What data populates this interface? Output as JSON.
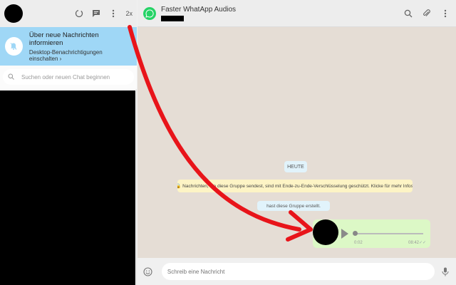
{
  "sidebar": {
    "speed_label": "2x",
    "notification": {
      "title": "Über neue Nachrichten informieren",
      "subtitle": "Desktop-Benachrichtigungen einschalten ›"
    },
    "search": {
      "placeholder": "Suchen oder neuen Chat beginnen"
    }
  },
  "chat": {
    "title": "Faster WhatApp Audios",
    "logo_text": "WhatsApp",
    "day_badge": "HEUTE",
    "encryption_notice": "🔒 Nachrichten, die     diese Gruppe sendest, sind mit Ende-zu-Ende-Verschlüsselung geschützt. Klicke für mehr Infos.",
    "created_notice": "hast diese Gruppe erstellt.",
    "audio": {
      "duration": "0:02",
      "time": "08:42",
      "ticks": "✓✓",
      "progress": 0.0
    }
  },
  "composer": {
    "placeholder": "Schreib eine Nachricht"
  },
  "colors": {
    "accent_green": "#25d366",
    "notify_blue": "#9fd7f6",
    "bubble_green": "#dcf8c6",
    "arrow_red": "#e8141a"
  }
}
